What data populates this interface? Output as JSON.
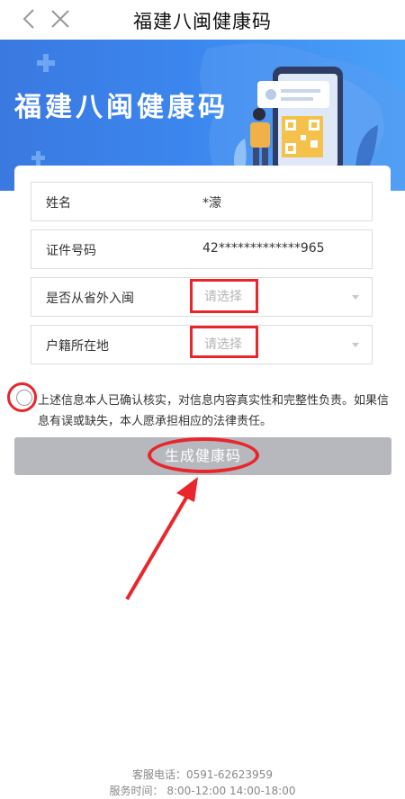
{
  "nav": {
    "title": "福建八闽健康码"
  },
  "banner": {
    "title": "福建八闽健康码"
  },
  "form": {
    "name": {
      "label": "姓名",
      "value": "*濛"
    },
    "id_number": {
      "label": "证件号码",
      "value": "42*************965"
    },
    "from_outside": {
      "label": "是否从省外入闽",
      "placeholder": "请选择"
    },
    "household": {
      "label": "户籍所在地",
      "placeholder": "请选择"
    }
  },
  "agreement": {
    "text": "上述信息本人已确认核实，对信息内容真实性和完整性负责。如果信息有误或缺失，本人愿承担相应的法律责任。",
    "checked": false
  },
  "generate_button": {
    "label": "生成健康码",
    "enabled": false
  },
  "footer": {
    "phone": "客服电话：0591-62623959",
    "hours": "服务时间：  8:00-12:00 14:00-18:00"
  },
  "colors": {
    "banner_blue": "#3b86ee",
    "annotation_red": "#e8262c",
    "button_disabled": "#b7b8bd"
  }
}
